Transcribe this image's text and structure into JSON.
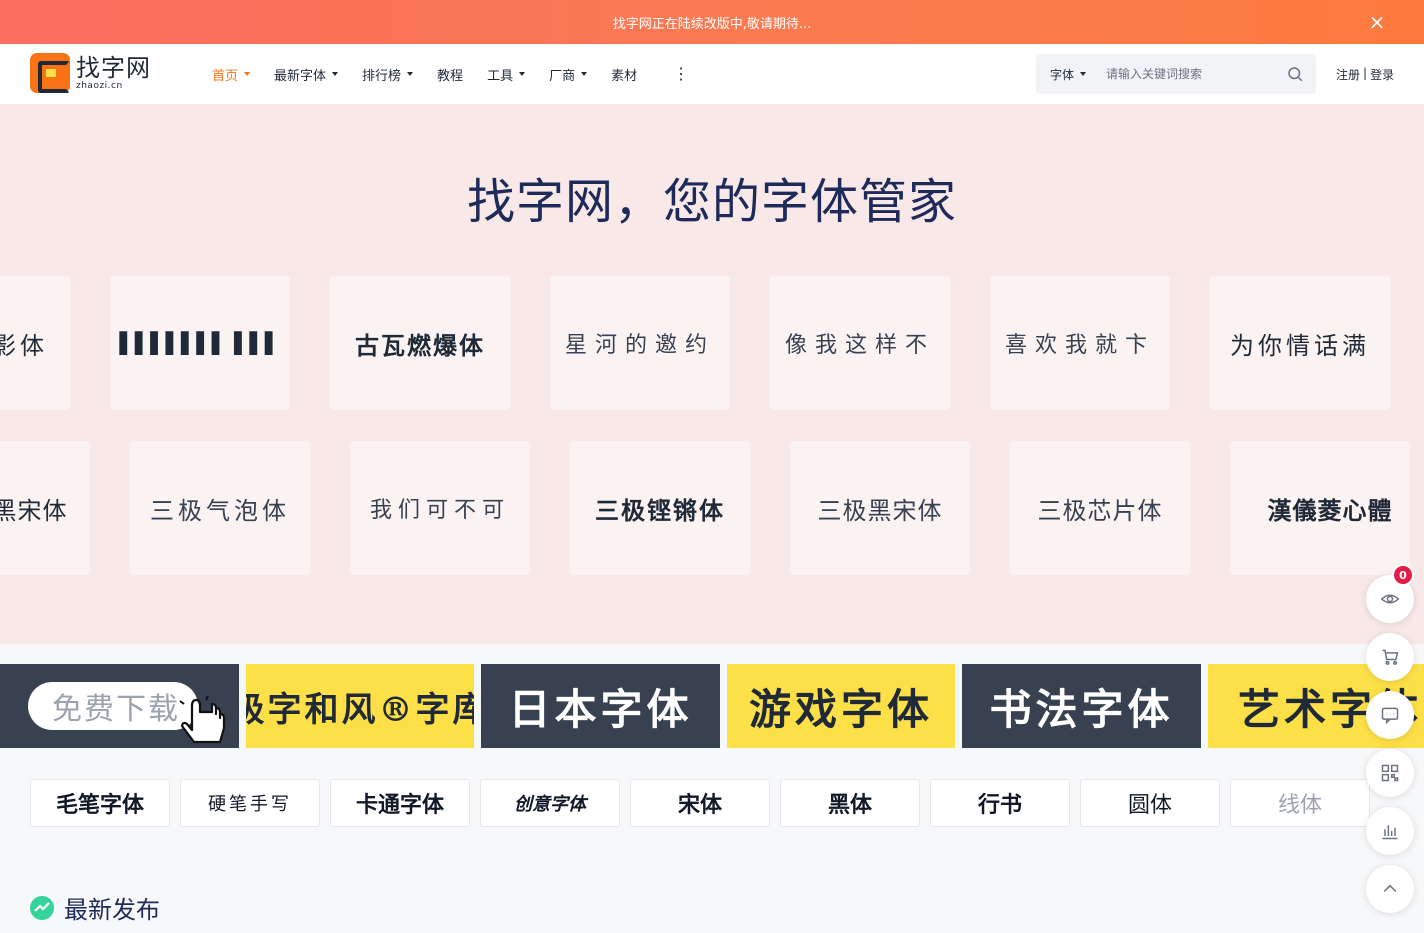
{
  "topbar": {
    "notice": "找字网正在陆续改版中,敬请期待...",
    "close": "×"
  },
  "logo": {
    "name": "找字网",
    "domain": "zhaozi.cn"
  },
  "nav": {
    "items": [
      {
        "label": "首页",
        "dropdown": true,
        "active": true
      },
      {
        "label": "最新字体",
        "dropdown": true
      },
      {
        "label": "排行榜",
        "dropdown": true
      },
      {
        "label": "教程",
        "dropdown": false
      },
      {
        "label": "工具",
        "dropdown": true
      },
      {
        "label": "厂商",
        "dropdown": true
      },
      {
        "label": "素材",
        "dropdown": false
      }
    ],
    "more": "⋮"
  },
  "search": {
    "type": "字体",
    "placeholder": "请输入关键词搜索"
  },
  "auth": {
    "register": "注册",
    "separator": "|",
    "login": "登录"
  },
  "hero": {
    "title": "找字网，您的字体管家",
    "row1": [
      "影体",
      "▌▌▌▌▌▌▌ ▌▌▌",
      "古瓦燃爆体",
      "星河的邀约",
      "像我这样不",
      "喜欢我就卞",
      "为你情话满"
    ],
    "row2": [
      "黑宋体",
      "三极气泡体",
      "我们可不可",
      "三极铿锵体",
      "三极黑宋体",
      "三极芯片体",
      "漢儀菱心體"
    ]
  },
  "banners": [
    {
      "label": "免费下载"
    },
    {
      "label": "极字和风®字库"
    },
    {
      "label": "日本字体"
    },
    {
      "label": "游戏字体"
    },
    {
      "label": "书法字体"
    },
    {
      "label": "艺术字体"
    }
  ],
  "tags": [
    "毛笔字体",
    "硬笔手写",
    "卡通字体",
    "创意字体",
    "宋体",
    "黑体",
    "行书",
    "圆体",
    "线体"
  ],
  "latest": {
    "title": "最新发布"
  },
  "float": {
    "badge": "0"
  },
  "colors": {
    "accent": "#f97316",
    "hero_bg": "#f8e9e8",
    "dark_banner": "#384150",
    "yellow_banner": "#fde047",
    "title": "#1e2a5a"
  }
}
